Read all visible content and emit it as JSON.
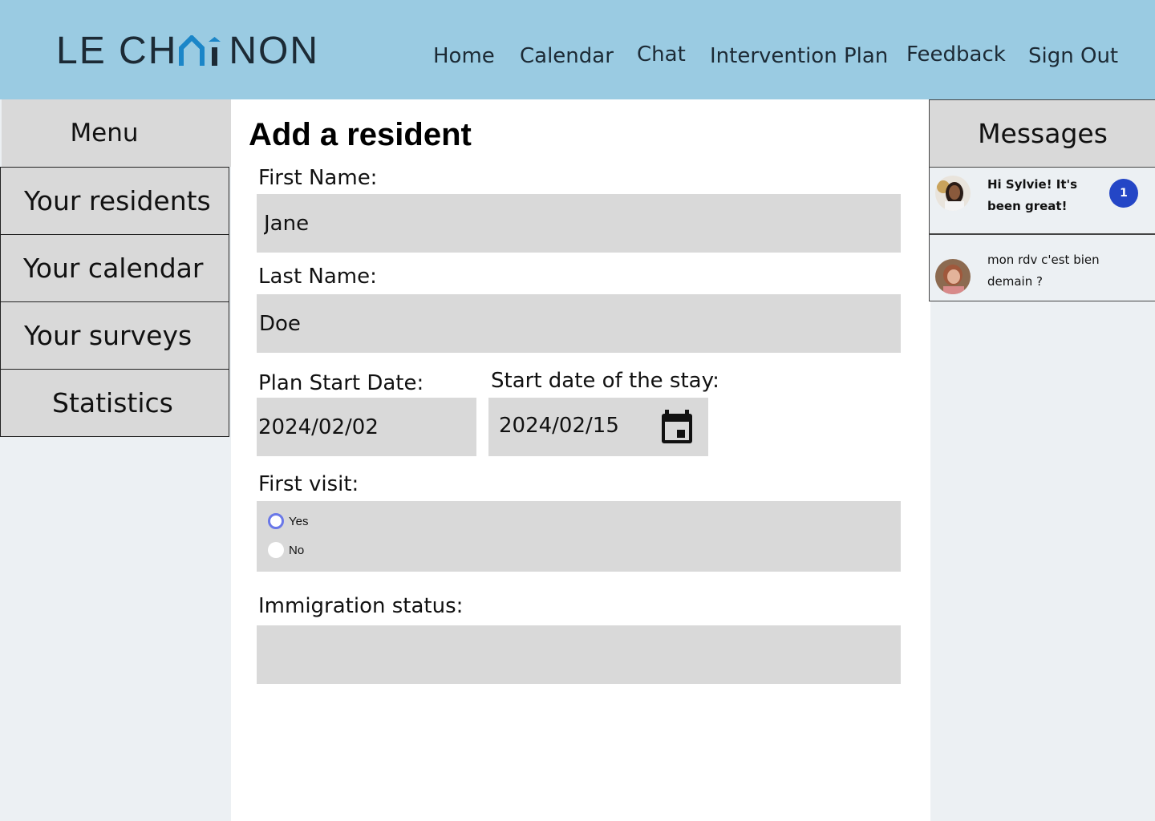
{
  "app": {
    "logo_left": "LE CH",
    "logo_right": "NON",
    "logo_text": "LE CHAINON"
  },
  "nav": {
    "items": [
      {
        "label": "Home"
      },
      {
        "label": "Calendar"
      },
      {
        "label": "Chat"
      },
      {
        "label": "Intervention Plan"
      },
      {
        "label": "Feedback"
      },
      {
        "label": "Sign Out"
      }
    ]
  },
  "sidebar": {
    "title": "Menu",
    "items": [
      {
        "label": "Your residents"
      },
      {
        "label": "Your calendar"
      },
      {
        "label": "Your surveys"
      },
      {
        "label": "Statistics"
      }
    ]
  },
  "form": {
    "title": "Add a resident",
    "first_name": {
      "label": "First Name:",
      "value": "Jane"
    },
    "last_name": {
      "label": "Last Name:",
      "value": "Doe"
    },
    "plan_start_date": {
      "label": "Plan Start Date:",
      "value": "2024/02/02"
    },
    "stay_start_date": {
      "label": "Start date of the stay:",
      "value": "2024/02/15",
      "icon": "calendar-icon"
    },
    "first_visit": {
      "label": "First visit:",
      "options": [
        {
          "label": "Yes",
          "selected": true
        },
        {
          "label": "No",
          "selected": false
        }
      ]
    },
    "immigration_status": {
      "label": "Immigration status:",
      "value": ""
    }
  },
  "messages": {
    "title": "Messages",
    "items": [
      {
        "text": "Hi Sylvie! It's been great!",
        "unread": true,
        "badge": "1"
      },
      {
        "text": "mon rdv c'est bien demain ?",
        "unread": false
      }
    ]
  },
  "colors": {
    "header_bg": "#9acbe2",
    "panel_gray": "#d9d9d9",
    "side_bg": "#ecf0f3",
    "logo_accent": "#1b86c8",
    "badge": "#2446c6",
    "radio_selected": "#6a78e8"
  }
}
